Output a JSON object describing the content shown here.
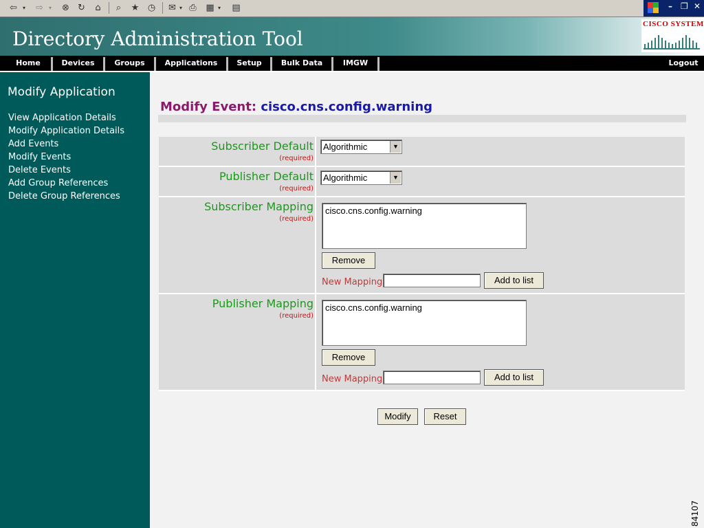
{
  "browser_toolbar": {
    "icons": [
      "back-icon",
      "forward-icon",
      "stop-icon",
      "refresh-icon",
      "home-icon",
      "search-icon",
      "favorites-icon",
      "history-icon",
      "mail-icon",
      "print-icon",
      "edit-icon",
      "discuss-icon"
    ]
  },
  "header": {
    "app_title": "Directory Administration Tool",
    "logo_text": "Cisco Systems"
  },
  "nav": {
    "items": [
      "Home",
      "Devices",
      "Groups",
      "Applications",
      "Setup",
      "Bulk Data",
      "IMGW"
    ],
    "logout": "Logout"
  },
  "sidebar": {
    "title": "Modify Application",
    "links": [
      "View Application Details",
      "Modify Application Details",
      "Add Events",
      "Modify Events",
      "Delete Events",
      "Add Group References",
      "Delete Group References"
    ]
  },
  "main": {
    "event_label": "Modify Event:",
    "event_name": "cisco.cns.config.warning",
    "subscriber_default": {
      "label": "Subscriber Default",
      "required": "(required)",
      "value": "Algorithmic"
    },
    "publisher_default": {
      "label": "Publisher Default",
      "required": "(required)",
      "value": "Algorithmic"
    },
    "subscriber_mapping": {
      "label": "Subscriber Mapping",
      "required": "(required)",
      "items": [
        "cisco.cns.config.warning"
      ],
      "remove": "Remove",
      "new_mapping": "New Mapping",
      "add": "Add to list"
    },
    "publisher_mapping": {
      "label": "Publisher Mapping",
      "required": "(required)",
      "items": [
        "cisco.cns.config.warning"
      ],
      "remove": "Remove",
      "new_mapping": "New Mapping",
      "add": "Add to list"
    },
    "modify_button": "Modify",
    "reset_button": "Reset"
  },
  "figure_number": "84107",
  "colors": {
    "sidebar": "#005a5a",
    "label_green": "#179c17",
    "required_red": "#c41212",
    "event_label": "#8b1a6b",
    "event_name": "#1a1aa8"
  }
}
